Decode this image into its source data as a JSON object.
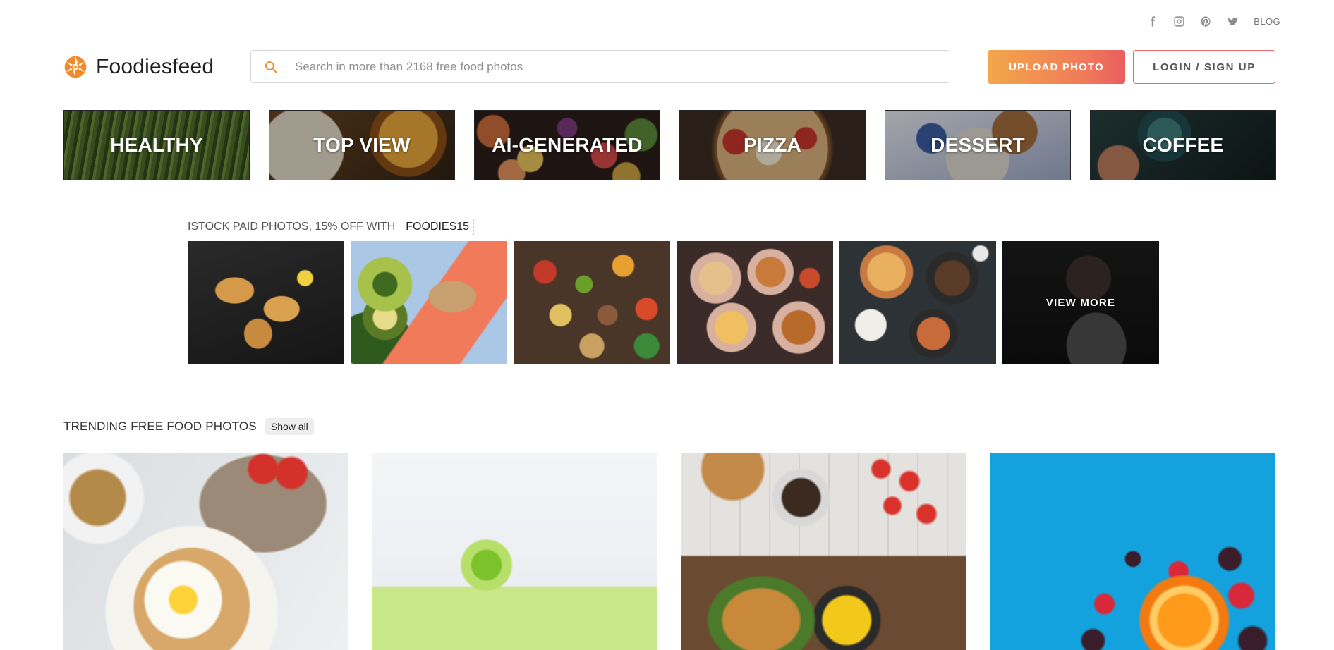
{
  "social": {
    "links": [
      "facebook",
      "instagram",
      "pinterest",
      "twitter"
    ],
    "blog_label": "BLOG"
  },
  "header": {
    "logo_text": "Foodiesfeed",
    "search_placeholder": "Search in more than 2168 free food photos",
    "upload_label": "UPLOAD PHOTO",
    "login_label": "LOGIN / SIGN UP"
  },
  "categories": [
    {
      "label": "HEALTHY"
    },
    {
      "label": "TOP VIEW"
    },
    {
      "label": "AI-GENERATED"
    },
    {
      "label": "PIZZA"
    },
    {
      "label": "DESSERT"
    },
    {
      "label": "COFFEE"
    }
  ],
  "istock": {
    "heading": "ISTOCK PAID PHOTOS, 15% OFF WITH",
    "promo_code": "FOODIES15",
    "view_more_label": "VIEW MORE"
  },
  "trending": {
    "heading": "TRENDING FREE FOOD PHOTOS",
    "show_all_label": "Show all"
  },
  "colors": {
    "accent_orange": "#f3a74a",
    "accent_red": "#ea5d5e",
    "logo_orange": "#f08a2a"
  }
}
